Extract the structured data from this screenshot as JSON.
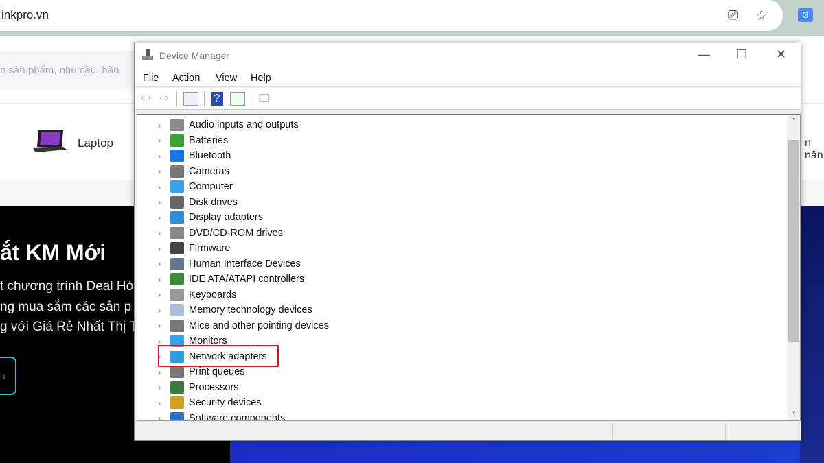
{
  "browser": {
    "url": "inkpro.vn",
    "icons": [
      "install-app-icon",
      "star-icon",
      "google-translate-icon"
    ]
  },
  "website": {
    "search_placeholder": "n sản phẩm, nhu cầu, hãn",
    "category_label": "Laptop",
    "category_right_label": "n nân",
    "banner_title": "ắt KM Mới",
    "banner_lines": [
      "t chương trình Deal Hó",
      "ng mua sắm các sản p",
      "g với Giá Rẻ Nhất Thị T"
    ],
    "banner_button": "›"
  },
  "window": {
    "title": "Device Manager",
    "controls": {
      "minimize": "—",
      "maximize": "☐",
      "close": "✕"
    },
    "menu": [
      "File",
      "Action",
      "View",
      "Help"
    ],
    "toolbar": [
      "back-icon",
      "forward-icon",
      "properties-icon",
      "help-icon",
      "update-driver-icon",
      "scan-hardware-icon"
    ],
    "tree": [
      {
        "label": "Audio inputs and outputs",
        "icon": "speaker-icon",
        "color": "#8a8a8a"
      },
      {
        "label": "Batteries",
        "icon": "battery-icon",
        "color": "#3aa336"
      },
      {
        "label": "Bluetooth",
        "icon": "bluetooth-icon",
        "color": "#1877e0"
      },
      {
        "label": "Cameras",
        "icon": "camera-icon",
        "color": "#777777"
      },
      {
        "label": "Computer",
        "icon": "computer-icon",
        "color": "#3aa0e8"
      },
      {
        "label": "Disk drives",
        "icon": "disk-drive-icon",
        "color": "#666666"
      },
      {
        "label": "Display adapters",
        "icon": "display-adapter-icon",
        "color": "#2f8fd0"
      },
      {
        "label": "DVD/CD-ROM drives",
        "icon": "dvd-drive-icon",
        "color": "#888888"
      },
      {
        "label": "Firmware",
        "icon": "firmware-icon",
        "color": "#444444"
      },
      {
        "label": "Human Interface Devices",
        "icon": "hid-icon",
        "color": "#667788"
      },
      {
        "label": "IDE ATA/ATAPI controllers",
        "icon": "ide-controller-icon",
        "color": "#3a8a3a"
      },
      {
        "label": "Keyboards",
        "icon": "keyboard-icon",
        "color": "#999999"
      },
      {
        "label": "Memory technology devices",
        "icon": "memory-icon",
        "color": "#a8c0d8"
      },
      {
        "label": "Mice and other pointing devices",
        "icon": "mouse-icon",
        "color": "#777777"
      },
      {
        "label": "Monitors",
        "icon": "monitor-icon",
        "color": "#3aa0e8"
      },
      {
        "label": "Network adapters",
        "icon": "network-adapter-icon",
        "color": "#2f9be0",
        "highlighted": true
      },
      {
        "label": "Print queues",
        "icon": "printer-icon",
        "color": "#777777"
      },
      {
        "label": "Processors",
        "icon": "processor-icon",
        "color": "#3a7a3a"
      },
      {
        "label": "Security devices",
        "icon": "security-device-icon",
        "color": "#d0a020"
      },
      {
        "label": "Software components",
        "icon": "software-component-icon",
        "color": "#2f6fc0"
      }
    ],
    "highlight_color": "#d4141c"
  }
}
